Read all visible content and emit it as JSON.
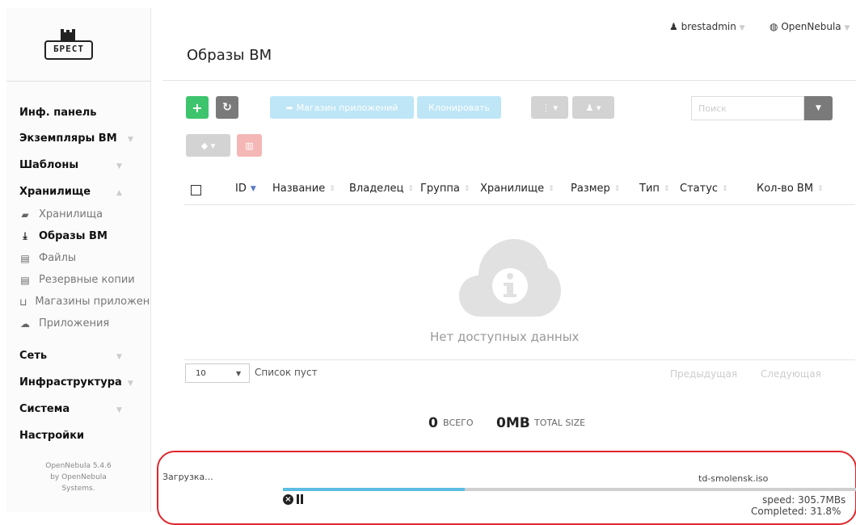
{
  "brand": {
    "logo_text": "БРЕСТ"
  },
  "sidebar": {
    "items": [
      {
        "label": "Инф. панель",
        "arrow": ""
      },
      {
        "label": "Экземпляры ВМ",
        "arrow": "▼"
      },
      {
        "label": "Шаблоны",
        "arrow": "▼"
      },
      {
        "label": "Хранилище",
        "arrow": "▲"
      }
    ],
    "storage_sub": [
      {
        "label": "Хранилища",
        "icon": "folder-open-icon",
        "active": false
      },
      {
        "label": "Образы ВМ",
        "icon": "download-icon",
        "active": true
      },
      {
        "label": "Файлы",
        "icon": "archive-icon",
        "active": false
      },
      {
        "label": "Резервные копии",
        "icon": "archive-icon",
        "active": false
      },
      {
        "label": "Магазины приложений",
        "icon": "cart-icon",
        "active": false
      },
      {
        "label": "Приложения",
        "icon": "cloud-icon",
        "active": false
      }
    ],
    "items2": [
      {
        "label": "Сеть",
        "arrow": "▼"
      },
      {
        "label": "Инфраструктура",
        "arrow": "▼"
      },
      {
        "label": "Система",
        "arrow": "▼"
      },
      {
        "label": "Настройки",
        "arrow": ""
      }
    ],
    "version_line1": "OpenNebula 5.4.6",
    "version_line2": "by OpenNebula",
    "version_line3": "Systems."
  },
  "header": {
    "title": "Образы ВМ",
    "user": "brestadmin",
    "zone": "OpenNebula"
  },
  "toolbar": {
    "add_label": "+",
    "refresh_label": "↻",
    "marketplace_label": "Магазин приложений",
    "clone_label": "Клонировать",
    "search_placeholder": "Поиск"
  },
  "table": {
    "columns": [
      "ID",
      "Название",
      "Владелец",
      "Группа",
      "Хранилище",
      "Размер",
      "Тип",
      "Статус",
      "Кол-во ВМ"
    ],
    "empty_text": "Нет доступных данных",
    "page_length": "10",
    "list_status": "Список пуст",
    "prev_label": "Предыдущая",
    "next_label": "Следующая"
  },
  "totals": {
    "count": "0",
    "count_label": "ВСЕГО",
    "size": "0MB",
    "size_label": "TOTAL SIZE"
  },
  "upload": {
    "label": "Загрузка...",
    "filename": "td-smolensk.iso",
    "progress_percent": 31.8,
    "speed": "speed: 305.7MBs",
    "completed": "Completed: 31.8%"
  },
  "colors": {
    "green": "#3ec46d",
    "progress": "#5bbde2",
    "highlight": "#e0262b"
  }
}
